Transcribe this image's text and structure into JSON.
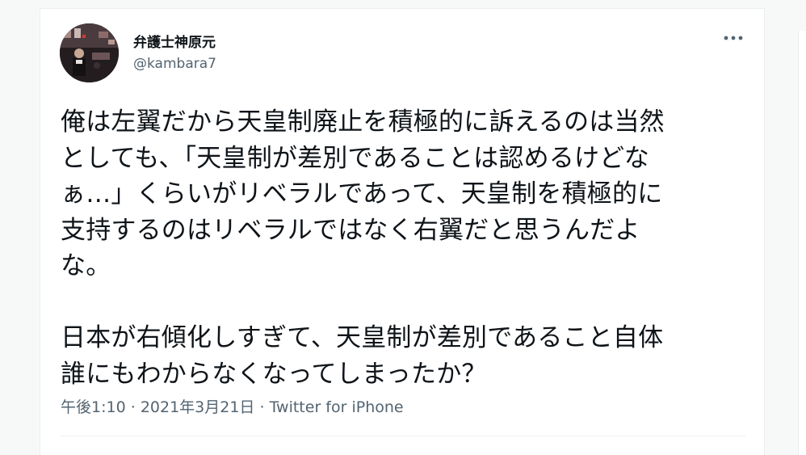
{
  "author": {
    "display_name": "弁護士神原元",
    "handle": "@kambara7",
    "avatar_icon": "profile-photo"
  },
  "actions": {
    "more_icon": "more-horizontal-icon"
  },
  "tweet": {
    "lines": [
      "俺は左翼だから天皇制廃止を積極的に訴えるのは当然",
      "としても、「天皇制が差別であることは認めるけどな",
      "ぁ…」くらいがリベラルであって、天皇制を積極的に",
      "支持するのはリベラルではなく右翼だと思うんだよ",
      "な。",
      "",
      "日本が右傾化しすぎて、天皇制が差別であること自体",
      "誰にもわからなくなってしまったか？"
    ],
    "time": "午後1:10",
    "separator": "·",
    "date": "2021年3月21日",
    "source": "Twitter for iPhone"
  },
  "colors": {
    "text": "#0f1419",
    "secondary": "#536471",
    "border": "#ebeef0"
  }
}
